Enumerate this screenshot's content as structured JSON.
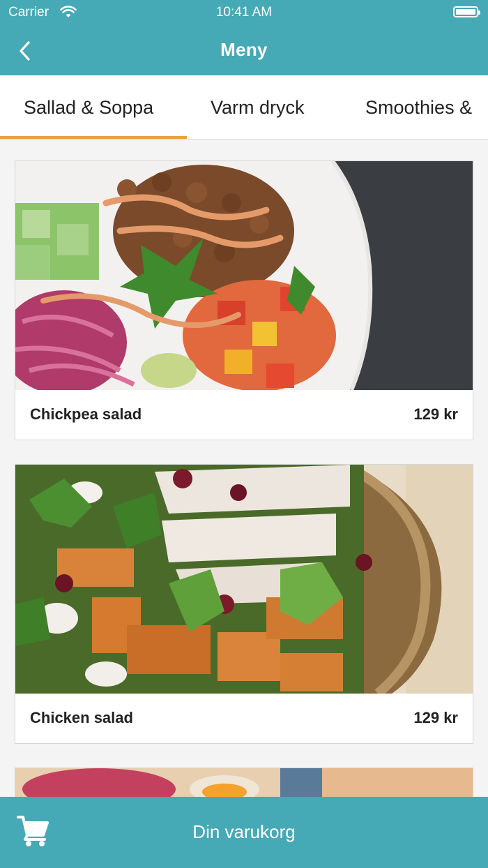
{
  "status_bar": {
    "carrier": "Carrier",
    "time": "10:41 AM"
  },
  "header": {
    "title": "Meny",
    "back_icon": "chevron-left-icon"
  },
  "tabs": [
    {
      "label": "Sallad & Soppa",
      "active": true
    },
    {
      "label": "Varm dryck",
      "active": false
    },
    {
      "label": "Smoothies &",
      "active": false
    }
  ],
  "menu_items": [
    {
      "name": "Chickpea salad",
      "price": "129 kr"
    },
    {
      "name": "Chicken salad",
      "price": "129 kr"
    }
  ],
  "footer": {
    "label": "Din varukorg",
    "icon": "shopping-cart-icon"
  },
  "colors": {
    "primary": "#45a9b6",
    "accent": "#e8a33d"
  }
}
